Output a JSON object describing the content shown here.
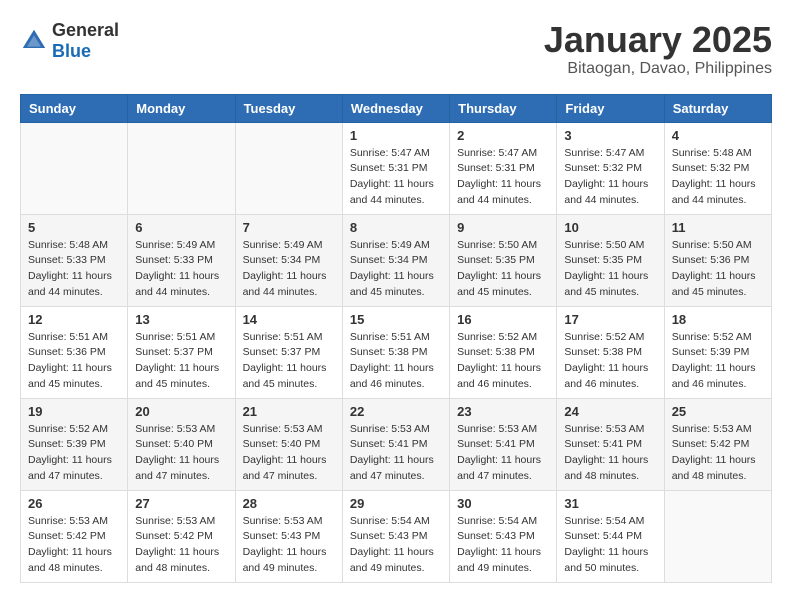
{
  "header": {
    "logo": {
      "text_general": "General",
      "text_blue": "Blue"
    },
    "title": "January 2025",
    "subtitle": "Bitaogan, Davao, Philippines"
  },
  "calendar": {
    "weekdays": [
      "Sunday",
      "Monday",
      "Tuesday",
      "Wednesday",
      "Thursday",
      "Friday",
      "Saturday"
    ],
    "weeks": [
      [
        {
          "day": "",
          "sunrise": "",
          "sunset": "",
          "daylight": ""
        },
        {
          "day": "",
          "sunrise": "",
          "sunset": "",
          "daylight": ""
        },
        {
          "day": "",
          "sunrise": "",
          "sunset": "",
          "daylight": ""
        },
        {
          "day": "1",
          "sunrise": "Sunrise: 5:47 AM",
          "sunset": "Sunset: 5:31 PM",
          "daylight": "Daylight: 11 hours and 44 minutes."
        },
        {
          "day": "2",
          "sunrise": "Sunrise: 5:47 AM",
          "sunset": "Sunset: 5:31 PM",
          "daylight": "Daylight: 11 hours and 44 minutes."
        },
        {
          "day": "3",
          "sunrise": "Sunrise: 5:47 AM",
          "sunset": "Sunset: 5:32 PM",
          "daylight": "Daylight: 11 hours and 44 minutes."
        },
        {
          "day": "4",
          "sunrise": "Sunrise: 5:48 AM",
          "sunset": "Sunset: 5:32 PM",
          "daylight": "Daylight: 11 hours and 44 minutes."
        }
      ],
      [
        {
          "day": "5",
          "sunrise": "Sunrise: 5:48 AM",
          "sunset": "Sunset: 5:33 PM",
          "daylight": "Daylight: 11 hours and 44 minutes."
        },
        {
          "day": "6",
          "sunrise": "Sunrise: 5:49 AM",
          "sunset": "Sunset: 5:33 PM",
          "daylight": "Daylight: 11 hours and 44 minutes."
        },
        {
          "day": "7",
          "sunrise": "Sunrise: 5:49 AM",
          "sunset": "Sunset: 5:34 PM",
          "daylight": "Daylight: 11 hours and 44 minutes."
        },
        {
          "day": "8",
          "sunrise": "Sunrise: 5:49 AM",
          "sunset": "Sunset: 5:34 PM",
          "daylight": "Daylight: 11 hours and 45 minutes."
        },
        {
          "day": "9",
          "sunrise": "Sunrise: 5:50 AM",
          "sunset": "Sunset: 5:35 PM",
          "daylight": "Daylight: 11 hours and 45 minutes."
        },
        {
          "day": "10",
          "sunrise": "Sunrise: 5:50 AM",
          "sunset": "Sunset: 5:35 PM",
          "daylight": "Daylight: 11 hours and 45 minutes."
        },
        {
          "day": "11",
          "sunrise": "Sunrise: 5:50 AM",
          "sunset": "Sunset: 5:36 PM",
          "daylight": "Daylight: 11 hours and 45 minutes."
        }
      ],
      [
        {
          "day": "12",
          "sunrise": "Sunrise: 5:51 AM",
          "sunset": "Sunset: 5:36 PM",
          "daylight": "Daylight: 11 hours and 45 minutes."
        },
        {
          "day": "13",
          "sunrise": "Sunrise: 5:51 AM",
          "sunset": "Sunset: 5:37 PM",
          "daylight": "Daylight: 11 hours and 45 minutes."
        },
        {
          "day": "14",
          "sunrise": "Sunrise: 5:51 AM",
          "sunset": "Sunset: 5:37 PM",
          "daylight": "Daylight: 11 hours and 45 minutes."
        },
        {
          "day": "15",
          "sunrise": "Sunrise: 5:51 AM",
          "sunset": "Sunset: 5:38 PM",
          "daylight": "Daylight: 11 hours and 46 minutes."
        },
        {
          "day": "16",
          "sunrise": "Sunrise: 5:52 AM",
          "sunset": "Sunset: 5:38 PM",
          "daylight": "Daylight: 11 hours and 46 minutes."
        },
        {
          "day": "17",
          "sunrise": "Sunrise: 5:52 AM",
          "sunset": "Sunset: 5:38 PM",
          "daylight": "Daylight: 11 hours and 46 minutes."
        },
        {
          "day": "18",
          "sunrise": "Sunrise: 5:52 AM",
          "sunset": "Sunset: 5:39 PM",
          "daylight": "Daylight: 11 hours and 46 minutes."
        }
      ],
      [
        {
          "day": "19",
          "sunrise": "Sunrise: 5:52 AM",
          "sunset": "Sunset: 5:39 PM",
          "daylight": "Daylight: 11 hours and 47 minutes."
        },
        {
          "day": "20",
          "sunrise": "Sunrise: 5:53 AM",
          "sunset": "Sunset: 5:40 PM",
          "daylight": "Daylight: 11 hours and 47 minutes."
        },
        {
          "day": "21",
          "sunrise": "Sunrise: 5:53 AM",
          "sunset": "Sunset: 5:40 PM",
          "daylight": "Daylight: 11 hours and 47 minutes."
        },
        {
          "day": "22",
          "sunrise": "Sunrise: 5:53 AM",
          "sunset": "Sunset: 5:41 PM",
          "daylight": "Daylight: 11 hours and 47 minutes."
        },
        {
          "day": "23",
          "sunrise": "Sunrise: 5:53 AM",
          "sunset": "Sunset: 5:41 PM",
          "daylight": "Daylight: 11 hours and 47 minutes."
        },
        {
          "day": "24",
          "sunrise": "Sunrise: 5:53 AM",
          "sunset": "Sunset: 5:41 PM",
          "daylight": "Daylight: 11 hours and 48 minutes."
        },
        {
          "day": "25",
          "sunrise": "Sunrise: 5:53 AM",
          "sunset": "Sunset: 5:42 PM",
          "daylight": "Daylight: 11 hours and 48 minutes."
        }
      ],
      [
        {
          "day": "26",
          "sunrise": "Sunrise: 5:53 AM",
          "sunset": "Sunset: 5:42 PM",
          "daylight": "Daylight: 11 hours and 48 minutes."
        },
        {
          "day": "27",
          "sunrise": "Sunrise: 5:53 AM",
          "sunset": "Sunset: 5:42 PM",
          "daylight": "Daylight: 11 hours and 48 minutes."
        },
        {
          "day": "28",
          "sunrise": "Sunrise: 5:53 AM",
          "sunset": "Sunset: 5:43 PM",
          "daylight": "Daylight: 11 hours and 49 minutes."
        },
        {
          "day": "29",
          "sunrise": "Sunrise: 5:54 AM",
          "sunset": "Sunset: 5:43 PM",
          "daylight": "Daylight: 11 hours and 49 minutes."
        },
        {
          "day": "30",
          "sunrise": "Sunrise: 5:54 AM",
          "sunset": "Sunset: 5:43 PM",
          "daylight": "Daylight: 11 hours and 49 minutes."
        },
        {
          "day": "31",
          "sunrise": "Sunrise: 5:54 AM",
          "sunset": "Sunset: 5:44 PM",
          "daylight": "Daylight: 11 hours and 50 minutes."
        },
        {
          "day": "",
          "sunrise": "",
          "sunset": "",
          "daylight": ""
        }
      ]
    ]
  }
}
